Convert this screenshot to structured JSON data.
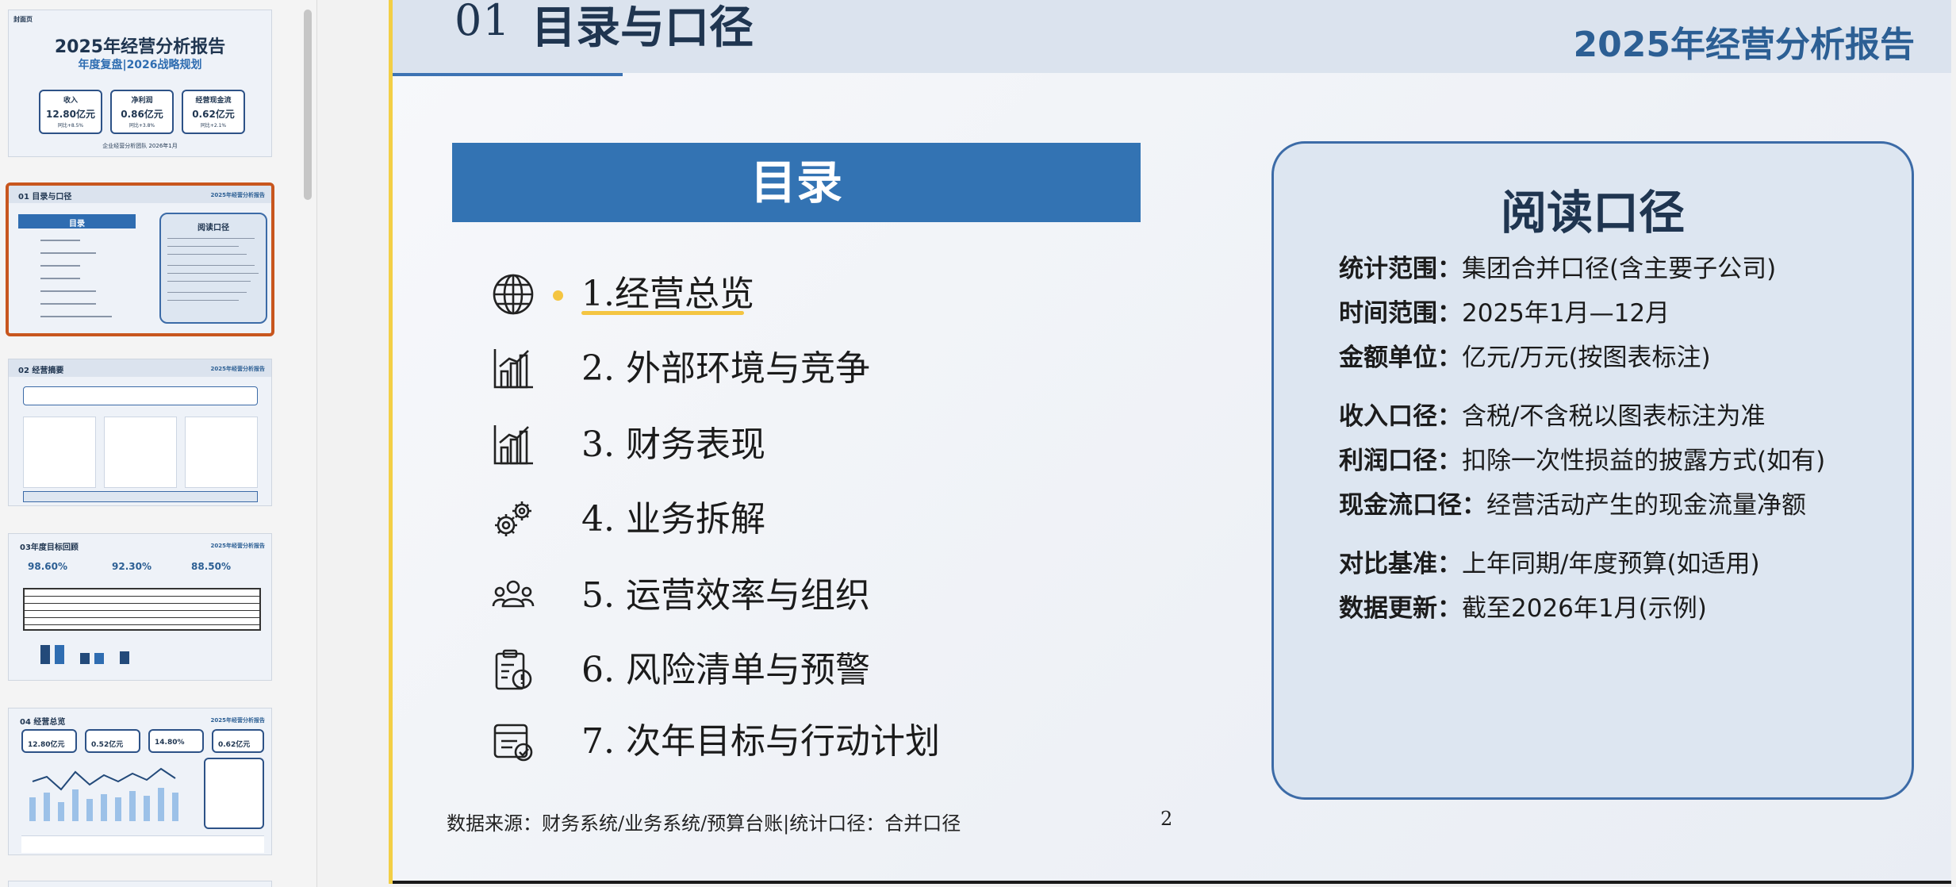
{
  "thumbnails": [
    {
      "index": 1,
      "tag": "封面页",
      "title": "2025年经营分析报告",
      "subtitle": "年度复盘|2026战略规划",
      "kpis": [
        {
          "label": "收入",
          "value": "12.80亿元",
          "note": "同比+8.5%"
        },
        {
          "label": "净利润",
          "value": "0.86亿元",
          "note": "同比+3.8%"
        },
        {
          "label": "经营现金流",
          "value": "0.62亿元",
          "note": "同比+2.1%"
        }
      ],
      "footer": "企业经营分析团队    2026年1月"
    },
    {
      "index": 2,
      "title": "01 目录与口径",
      "brand": "2025年经营分析报告",
      "toc_head": "目录",
      "panel_head": "阅读口径"
    },
    {
      "index": 3,
      "title": "02 经营摘要",
      "brand": "2025年经营分析报告"
    },
    {
      "index": 4,
      "title": "03年度目标回顾",
      "brand": "2025年经营分析报告",
      "kpis": [
        "98.60%",
        "92.30%",
        "88.50%"
      ]
    },
    {
      "index": 5,
      "title": "04 经营总览",
      "brand": "2025年经营分析报告",
      "kpis": [
        "12.80亿元",
        "0.52亿元",
        "14.80%",
        "0.62亿元"
      ]
    }
  ],
  "slide": {
    "number": "01",
    "heading": "目录与口径",
    "report_title": "2025年经营分析报告",
    "toc_banner": "目录",
    "toc_items": [
      {
        "num": "1.",
        "label": "经营总览",
        "icon": "globe-icon",
        "active": true
      },
      {
        "num": "2.",
        "label": "外部环境与竞争",
        "icon": "bar-chart-icon"
      },
      {
        "num": "3.",
        "label": "财务表现",
        "icon": "bar-chart-icon"
      },
      {
        "num": "4.",
        "label": "业务拆解",
        "icon": "gears-icon"
      },
      {
        "num": "5.",
        "label": "运营效率与组织",
        "icon": "people-icon"
      },
      {
        "num": "6.",
        "label": "风险清单与预警",
        "icon": "clipboard-alert-icon"
      },
      {
        "num": "7.",
        "label": "次年目标与行动计划",
        "icon": "checklist-icon"
      }
    ],
    "source": "数据来源：财务系统/业务系统/预算台账|统计口径：合并口径",
    "page_number": "2",
    "reading_panel": {
      "title": "阅读口径",
      "rows": [
        {
          "key": "统计范围：",
          "value": "集团合并口径(含主要子公司)"
        },
        {
          "key": "时间范围：",
          "value": "2025年1月—12月"
        },
        {
          "key": "金额单位：",
          "value": "亿元/万元(按图表标注)"
        },
        {
          "key": "收入口径：",
          "value": "含税/不含税以图表标注为准"
        },
        {
          "key": "利润口径：",
          "value": "扣除一次性损益的披露方式(如有)"
        },
        {
          "key": "现金流口径：",
          "value": "经营活动产生的现金流量净额"
        },
        {
          "key": "对比基准：",
          "value": "上年同期/年度预算(如适用)"
        },
        {
          "key": "数据更新：",
          "value": "截至2026年1月(示例)"
        }
      ]
    }
  },
  "colors": {
    "accent": "#3373b3",
    "navy": "#1f3550",
    "highlight": "#f4c542",
    "selection": "#c8561e",
    "panel": "#dde6f1"
  }
}
